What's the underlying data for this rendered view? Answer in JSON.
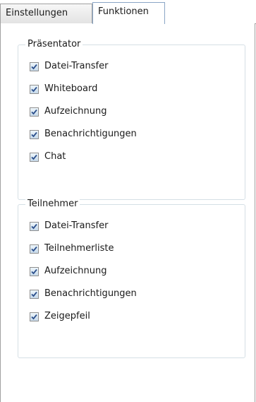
{
  "tabs": [
    {
      "label": "Einstellungen",
      "active": false
    },
    {
      "label": "Funktionen",
      "active": true
    }
  ],
  "groups": {
    "presenter": {
      "title": "Präsentator",
      "items": [
        {
          "label": "Datei-Transfer",
          "checked": true
        },
        {
          "label": "Whiteboard",
          "checked": true
        },
        {
          "label": "Aufzeichnung",
          "checked": true
        },
        {
          "label": "Benachrichtigungen",
          "checked": true
        },
        {
          "label": "Chat",
          "checked": true
        }
      ]
    },
    "participants": {
      "title": "Teilnehmer",
      "items": [
        {
          "label": "Datei-Transfer",
          "checked": true
        },
        {
          "label": "Teilnehmerliste",
          "checked": true
        },
        {
          "label": "Aufzeichnung",
          "checked": true
        },
        {
          "label": "Benachrichtigungen",
          "checked": true
        },
        {
          "label": "Zeigepfeil",
          "checked": true
        }
      ]
    }
  },
  "colors": {
    "checkmark": "#2b4f8c",
    "tab_active_border": "#8aa6c6",
    "group_border": "#d5dfe5"
  },
  "icons": {
    "checkbox": "check-mark-icon"
  }
}
